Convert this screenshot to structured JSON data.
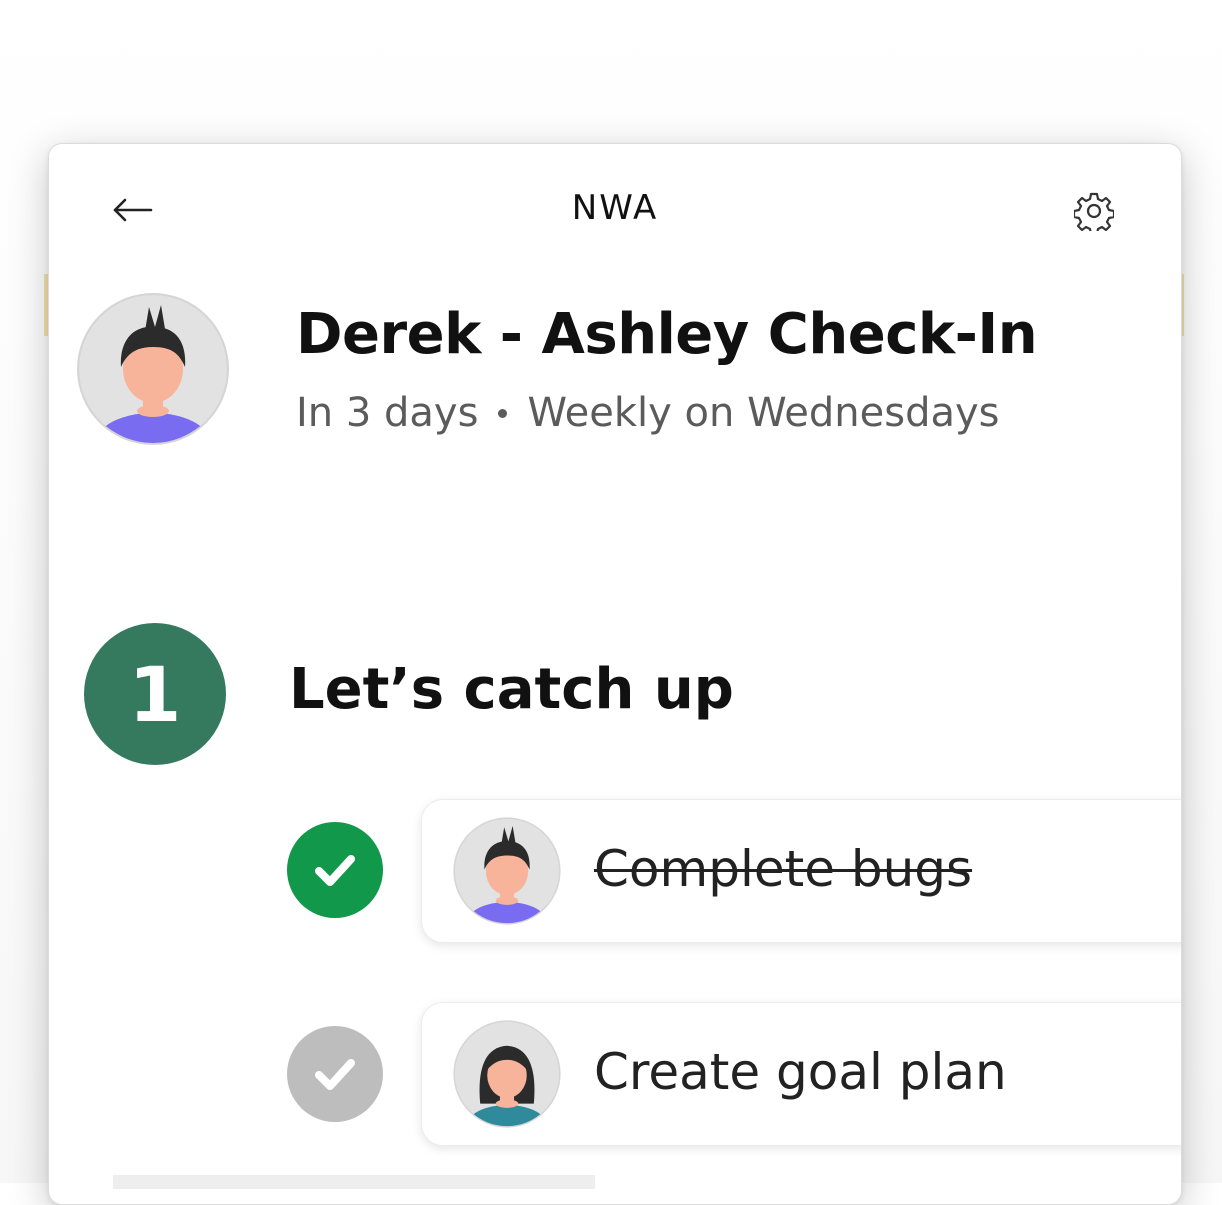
{
  "header": {
    "back_icon": "arrow-left-icon",
    "title": "NWA",
    "settings_icon": "gear-icon"
  },
  "meeting": {
    "title": "Derek - Ashley Check-In",
    "when": "In 3 days",
    "recurrence": "Weekly on Wednesdays",
    "avatar_icon": "male-avatar"
  },
  "sections": [
    {
      "number": "1",
      "title": "Let’s catch up",
      "number_color": "#357a5f",
      "items": [
        {
          "label": "Complete bugs",
          "completed": true,
          "check_color": "#11984a",
          "avatar_icon": "male-avatar"
        },
        {
          "label": "Create goal plan",
          "completed": false,
          "check_color": "#bdbdbd",
          "avatar_icon": "female-avatar"
        }
      ]
    }
  ],
  "colors": {
    "accent_green": "#357a5f",
    "check_complete": "#11984a",
    "check_pending": "#bdbdbd",
    "text_primary": "#111111",
    "text_secondary": "#5b5b5b"
  }
}
